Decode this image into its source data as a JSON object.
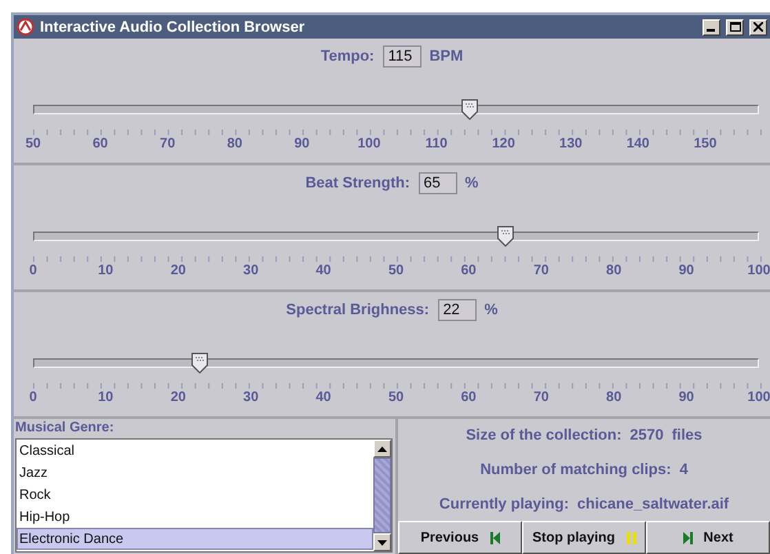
{
  "window": {
    "title": "Interactive Audio Collection Browser"
  },
  "sliders": [
    {
      "label": "Tempo:",
      "value": "115",
      "unit": "BPM",
      "level": 0.602,
      "tick_labels": [
        "50",
        "60",
        "70",
        "80",
        "90",
        "100",
        "110",
        "120",
        "130",
        "140",
        "150"
      ]
    },
    {
      "label": "Beat Strength:",
      "value": "65",
      "unit": "%",
      "level": 0.65,
      "tick_labels": [
        "0",
        "10",
        "20",
        "30",
        "40",
        "50",
        "60",
        "70",
        "80",
        "90",
        "100"
      ]
    },
    {
      "label": "Spectral Brighness:",
      "value": "22",
      "unit": "%",
      "level": 0.23,
      "tick_labels": [
        "0",
        "10",
        "20",
        "30",
        "40",
        "50",
        "60",
        "70",
        "80",
        "90",
        "100"
      ]
    }
  ],
  "genre": {
    "label": "Musical Genre:",
    "items": [
      {
        "label": "Classical",
        "selected": false
      },
      {
        "label": "Jazz",
        "selected": false
      },
      {
        "label": "Rock",
        "selected": false
      },
      {
        "label": "Hip-Hop",
        "selected": false
      },
      {
        "label": "Electronic Dance",
        "selected": true
      }
    ]
  },
  "info": [
    {
      "label": "Size of the collection:",
      "value": "2570",
      "unit": "files"
    },
    {
      "label": "Number of matching clips:",
      "value": "4"
    },
    {
      "label": "Currently playing:",
      "value": "chicane_saltwater.aif"
    }
  ],
  "buttons": [
    {
      "label": "Previous",
      "kind": "previous"
    },
    {
      "label": "Stop playing",
      "kind": "pause"
    },
    {
      "label": "Next",
      "kind": "next"
    }
  ]
}
